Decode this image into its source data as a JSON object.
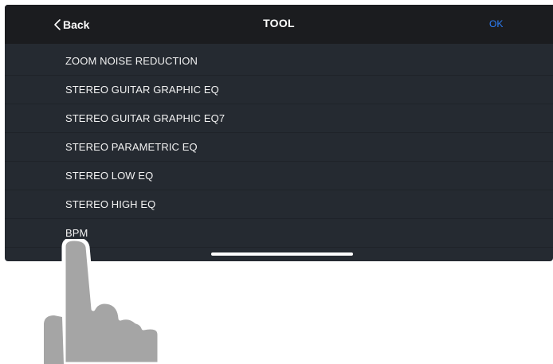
{
  "nav": {
    "back_label": "Back",
    "title": "TOOL",
    "ok_label": "OK"
  },
  "list": {
    "items": [
      {
        "label": "ZOOM NOISE REDUCTION"
      },
      {
        "label": "STEREO GUITAR GRAPHIC EQ"
      },
      {
        "label": "STEREO GUITAR GRAPHIC EQ7"
      },
      {
        "label": "STEREO PARAMETRIC EQ"
      },
      {
        "label": "STEREO LOW EQ"
      },
      {
        "label": "STEREO HIGH EQ"
      },
      {
        "label": "BPM"
      }
    ]
  },
  "icons": {
    "back": "chevron-left-icon",
    "pointer": "pointing-hand-icon"
  },
  "colors": {
    "background": "#252a31",
    "nav_bar": "#1b1c1f",
    "ok_accent": "#2d7ff9",
    "text": "#f2f2f2",
    "hand": "#a5a5a5"
  }
}
